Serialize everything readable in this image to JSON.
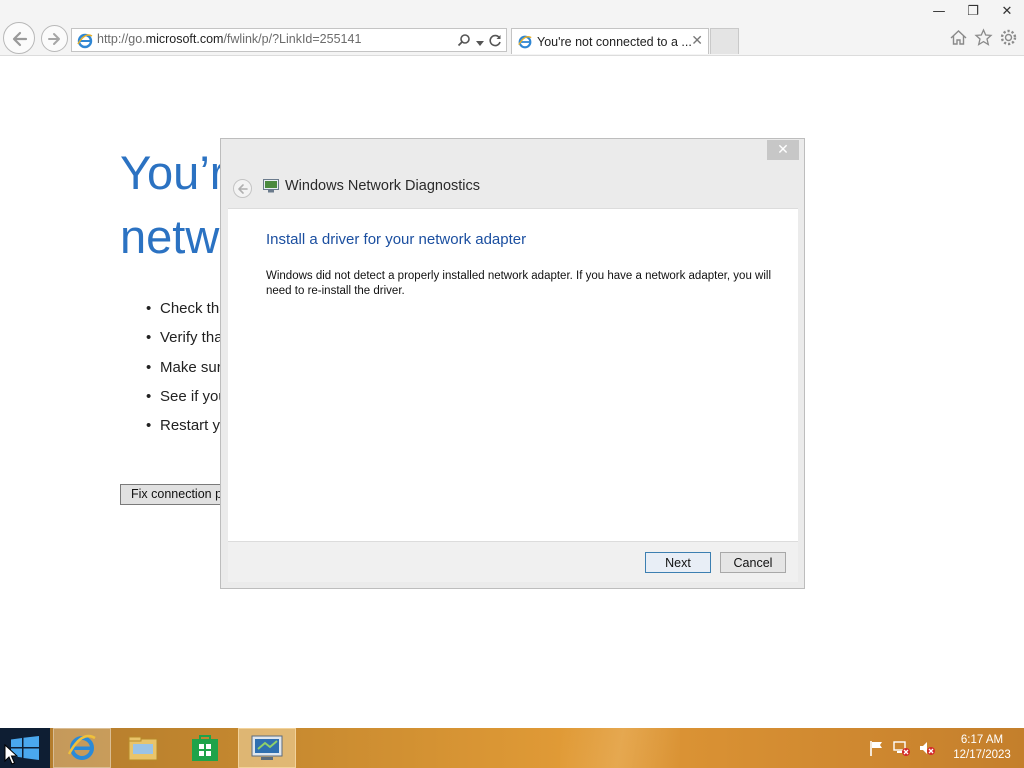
{
  "browser": {
    "address": {
      "prefix": "http://go.",
      "domain": "microsoft.com",
      "path": "/fwlink/p/?LinkId=255141"
    },
    "tab_title": "You're not connected to a ...",
    "tab_close": "✕"
  },
  "window_controls": {
    "minimize": "—",
    "restore": "❐",
    "close": "✕"
  },
  "page": {
    "heading_line1": "You’r",
    "heading_line2": "netw",
    "bullets": [
      "Check tha",
      "Verify tha",
      "Make sur",
      "See if you",
      "Restart yo"
    ],
    "fix_button": "Fix connection pr"
  },
  "dialog": {
    "close": "✕",
    "title": "Windows Network Diagnostics",
    "heading": "Install a driver for your network adapter",
    "message": "Windows did not detect a properly installed network adapter. If you have a network adapter, you will need to re-install the driver.",
    "next_button": "Next",
    "cancel_button": "Cancel"
  },
  "taskbar": {
    "items": [
      "internet-explorer",
      "file-explorer",
      "store",
      "network-diagnostics"
    ],
    "clock": {
      "time": "6:17 AM",
      "date": "12/17/2023"
    }
  },
  "colors": {
    "page_heading": "#2b72c2",
    "dialog_heading": "#1b4fa0",
    "taskbar": "#d08a32",
    "start_button": "#0e1e33"
  }
}
